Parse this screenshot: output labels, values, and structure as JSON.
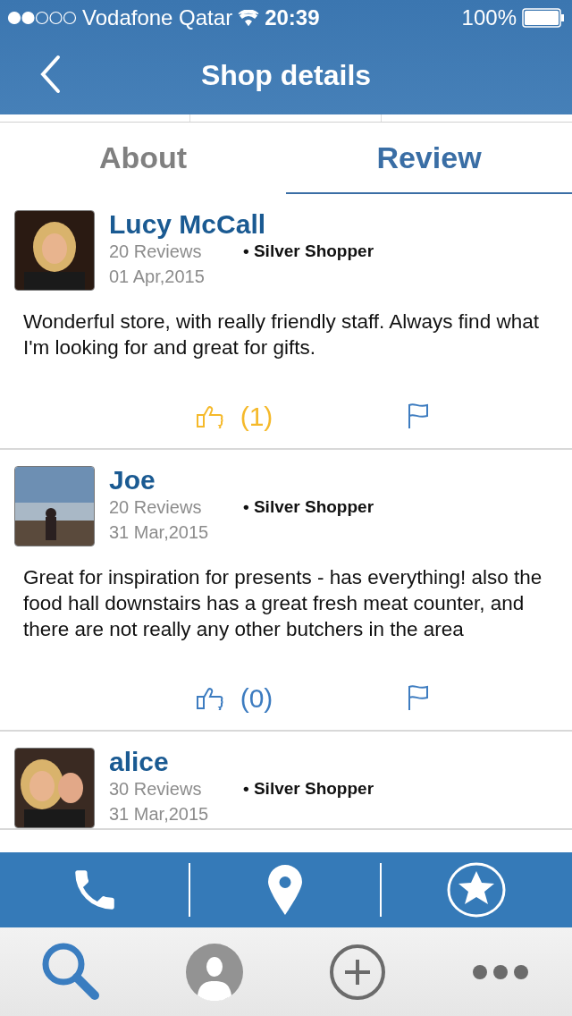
{
  "status_bar": {
    "carrier": "Vodafone Qatar",
    "time": "20:39",
    "battery": "100%"
  },
  "nav": {
    "title": "Shop details"
  },
  "tabs": [
    {
      "label": "About",
      "selected": false
    },
    {
      "label": "Review",
      "selected": true
    }
  ],
  "reviews": [
    {
      "name": "Lucy McCall",
      "reviews": "20 Reviews",
      "badge": "• Silver Shopper",
      "date": "01 Apr,2015",
      "text": "Wonderful store, with really friendly staff. Always find what I'm looking for and great for gifts.",
      "likes": "(1)",
      "liked": true
    },
    {
      "name": "Joe",
      "reviews": "20 Reviews",
      "badge": "• Silver Shopper",
      "date": "31 Mar,2015",
      "text": "Great for inspiration for presents - has everything! also the food hall downstairs has a great fresh meat counter, and there are not really any other butchers in the area",
      "likes": "(0)",
      "liked": false
    },
    {
      "name": "alice",
      "reviews": "30 Reviews",
      "badge": "• Silver Shopper",
      "date": "31 Mar,2015"
    }
  ],
  "action_bar": [
    {
      "kind": "phone"
    },
    {
      "kind": "location"
    },
    {
      "kind": "star"
    }
  ],
  "tab_bar": [
    {
      "kind": "search",
      "selected": true
    },
    {
      "kind": "profile",
      "selected": false
    },
    {
      "kind": "add",
      "selected": false
    },
    {
      "kind": "more",
      "selected": false
    }
  ]
}
